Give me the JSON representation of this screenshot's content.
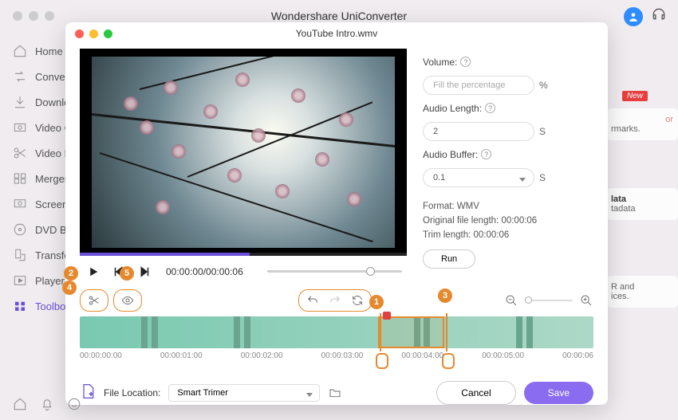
{
  "app": {
    "title": "Wondershare UniConverter"
  },
  "sidebar": {
    "items": [
      {
        "label": "Home",
        "icon": "home"
      },
      {
        "label": "Convert",
        "icon": "convert"
      },
      {
        "label": "Downloa",
        "icon": "download"
      },
      {
        "label": "Video C",
        "icon": "compress"
      },
      {
        "label": "Video E",
        "icon": "scissors"
      },
      {
        "label": "Merger",
        "icon": "merger"
      },
      {
        "label": "Screen R",
        "icon": "record"
      },
      {
        "label": "DVD Bu",
        "icon": "dvd"
      },
      {
        "label": "Transfer",
        "icon": "transfer"
      },
      {
        "label": "Player",
        "icon": "player"
      },
      {
        "label": "Toolbox",
        "icon": "toolbox"
      }
    ]
  },
  "right_peek": {
    "new": "New",
    "card1a": "or",
    "card1b": "rmarks.",
    "card2a": "lata",
    "card2b": "tadata",
    "card3a": "R and",
    "card3b": "ices."
  },
  "modal": {
    "title": "YouTube Intro.wmv",
    "timecode": "00:00:00/00:00:06",
    "volume_label": "Volume:",
    "volume_placeholder": "Fill the percentage",
    "volume_unit": "%",
    "audiolen_label": "Audio Length:",
    "audiolen_value": "2",
    "audiolen_unit": "S",
    "audiobuf_label": "Audio Buffer:",
    "audiobuf_value": "0.1",
    "audiobuf_unit": "S",
    "format": "Format: WMV",
    "orig": "Original file length: 00:00:06",
    "trim": "Trim length: 00:00:06",
    "run": "Run"
  },
  "timeline": {
    "ticks": [
      "00:00:00:00",
      "00:00:01:00",
      "00:00:02:00",
      "00:00:03:00",
      "00:00:04:00",
      "00:00:05:00",
      "00:00:06"
    ]
  },
  "footer": {
    "label": "File Location:",
    "loc": "Smart Trimer",
    "cancel": "Cancel",
    "save": "Save"
  },
  "anno": {
    "a1": "1",
    "a2": "2",
    "a3": "3",
    "a4": "4",
    "a5": "5"
  }
}
